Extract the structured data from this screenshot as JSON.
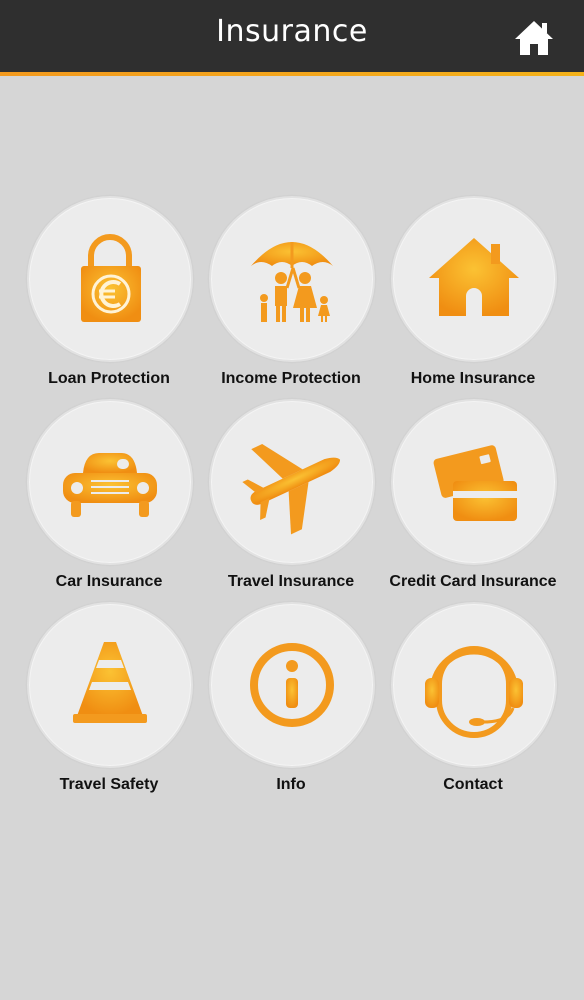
{
  "header": {
    "title": "Insurance",
    "home_icon": "home-icon"
  },
  "colors": {
    "header_bg": "#2f2f2f",
    "accent": "#f39a1e",
    "icon_orange": "#f39a1e",
    "background": "#d6d6d6",
    "tile_circle": "#ececec"
  },
  "tiles": [
    {
      "label": "Loan Protection",
      "icon": "euro-lock-icon"
    },
    {
      "label": "Income Protection",
      "icon": "family-umbrella-icon"
    },
    {
      "label": "Home Insurance",
      "icon": "house-icon"
    },
    {
      "label": "Car Insurance",
      "icon": "car-icon"
    },
    {
      "label": "Travel Insurance",
      "icon": "airplane-icon"
    },
    {
      "label": "Credit Card Insurance",
      "icon": "credit-cards-icon"
    },
    {
      "label": "Travel Safety",
      "icon": "traffic-cone-icon"
    },
    {
      "label": "Info",
      "icon": "info-icon"
    },
    {
      "label": "Contact",
      "icon": "headset-icon"
    }
  ]
}
